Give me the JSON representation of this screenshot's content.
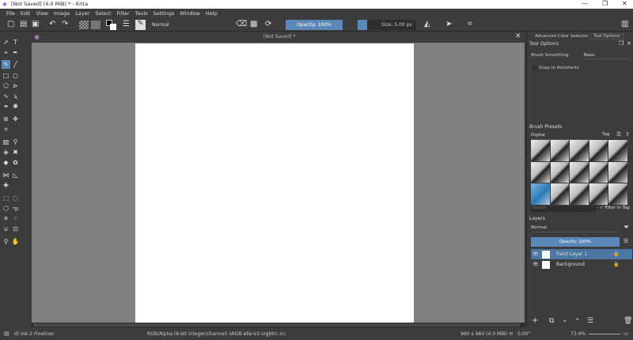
{
  "window": {
    "title": "[Not Saved]  (4.0 MiB)  * - Krita",
    "minimize": "—",
    "maximize": "❐",
    "close": "✕"
  },
  "menu": [
    "File",
    "Edit",
    "View",
    "Image",
    "Layer",
    "Select",
    "Filter",
    "Tools",
    "Settings",
    "Window",
    "Help"
  ],
  "toolbar": {
    "blend_mode": "Normal",
    "opacity": "Opacity: 100%",
    "size": "Size: 5.00 px"
  },
  "document_tab": {
    "label": "[Not Saved]  *"
  },
  "dock": {
    "tabs": [
      "Advanced Color Selector",
      "Tool Options"
    ],
    "tool_options": {
      "title": "Tool Options",
      "brush_smoothing_label": "Brush Smoothing:",
      "brush_smoothing_value": "Basic",
      "snap_label": "Snap to Assistants"
    },
    "brush_presets": {
      "title": "Brush Presets",
      "tag_select": "Digital",
      "tag_label": "Tag",
      "search_placeholder": "Search",
      "filter_label": "Filter in Tag",
      "count": 15,
      "selected_index": 10
    },
    "layers": {
      "title": "Layers",
      "blend_mode": "Normal",
      "opacity": "Opacity:  100%",
      "items": [
        {
          "name": "Paint Layer 1",
          "selected": true
        },
        {
          "name": "Background",
          "selected": false,
          "locked": true
        }
      ]
    }
  },
  "status": {
    "brush": "d) Ink-2 Fineliner",
    "color_profile": "RGB/Alpha (8-bit integer/channel)  sRGB-elle-V2-srgbtrc.icc",
    "image_size": "960 x 960 (4.0 MiB)",
    "rotation": "0.00°",
    "zoom": "73.4%"
  }
}
